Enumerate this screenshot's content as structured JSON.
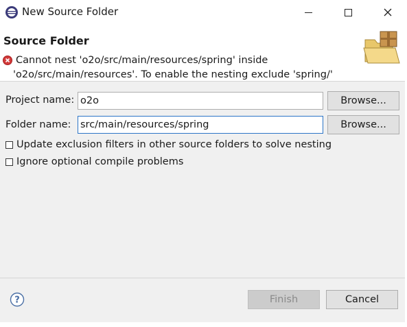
{
  "window": {
    "title": "New Source Folder",
    "icons": {
      "app": "eclipse-icon",
      "minimize": "minimize-icon",
      "maximize": "maximize-icon",
      "close": "close-icon"
    }
  },
  "header": {
    "title": "Source Folder",
    "error_line1": "Cannot nest 'o2o/src/main/resources/spring' inside",
    "error_line2": "'o2o/src/main/resources'. To enable the nesting exclude 'spring/'",
    "icons": {
      "error": "error-icon",
      "banner": "new-folder-wizard-icon"
    }
  },
  "form": {
    "project_label": "Project name:",
    "project_value": "o2o",
    "folder_label": "Folder name:",
    "folder_value": "src/main/resources/spring",
    "browse_label": "Browse...",
    "options": [
      {
        "label": "Update exclusion filters in other source folders to solve nesting",
        "checked": false
      },
      {
        "label": "Ignore optional compile problems",
        "checked": false
      }
    ]
  },
  "footer": {
    "finish_label": "Finish",
    "cancel_label": "Cancel",
    "help_icon": "help-icon"
  },
  "colors": {
    "error": "#d23a3a",
    "focus_border": "#2b74c7",
    "body_background": "#f0f0f0"
  }
}
